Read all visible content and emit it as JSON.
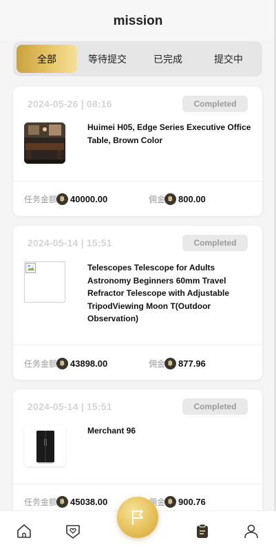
{
  "header": {
    "title": "mission"
  },
  "tabs": [
    {
      "label": "全部",
      "active": true
    },
    {
      "label": "等待提交",
      "active": false
    },
    {
      "label": "已完成",
      "active": false
    },
    {
      "label": "提交中",
      "active": false
    }
  ],
  "labels": {
    "amount": "任务金额",
    "commission": "佣金",
    "coin_symbol": "฿"
  },
  "orders": [
    {
      "date": "2024-05-26 | 08:16",
      "status": "Completed",
      "name": "Huimei H05, Edge Series Executive Office Table, Brown Color",
      "image": "office-room-photo",
      "amount": "40000.00",
      "commission": "800.00"
    },
    {
      "date": "2024-05-14 | 15:51",
      "status": "Completed",
      "name": "Telescopes Telescope for Adults Astronomy Beginners 60mm Travel Refractor Telescope with Adjustable TripodViewing Moon T(Outdoor Observation)",
      "image": "broken-image",
      "amount": "43898.00",
      "commission": "877.96"
    },
    {
      "date": "2024-05-14 | 15:51",
      "status": "Completed",
      "name": "Merchant 96",
      "image": "black-refrigerator-photo",
      "amount": "45038.00",
      "commission": "900.76"
    }
  ],
  "bottom_nav": [
    {
      "icon": "home-icon"
    },
    {
      "icon": "shield-heart-icon"
    },
    {
      "icon": "flag-icon",
      "center": true
    },
    {
      "icon": "clipboard-icon",
      "active": true
    },
    {
      "icon": "user-icon"
    }
  ],
  "colors": {
    "accent_gold": "#e6c05a",
    "status_bg": "#e9e9e9",
    "coin": "#3b342a"
  }
}
